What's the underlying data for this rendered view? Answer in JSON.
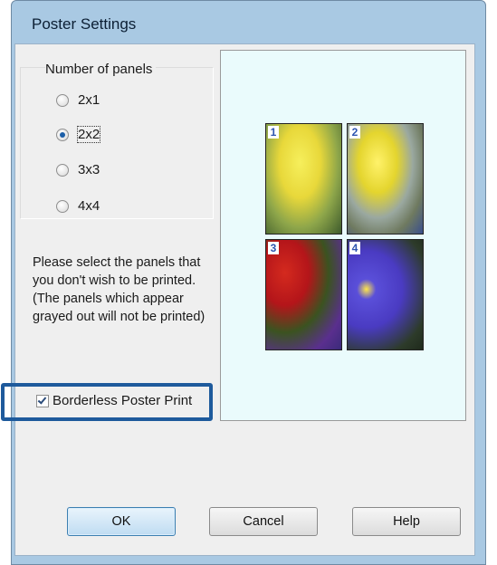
{
  "window": {
    "title": "Poster Settings",
    "colors": {
      "frame": "#a9c9e3",
      "client": "#efefef",
      "preview_bg": "#eafbfc",
      "highlight": "#1e5a9c"
    }
  },
  "panels_group": {
    "legend": "Number of panels",
    "options": [
      {
        "label": "2x1",
        "checked": false
      },
      {
        "label": "2x2",
        "checked": true
      },
      {
        "label": "3x3",
        "checked": false
      },
      {
        "label": "4x4",
        "checked": false
      }
    ]
  },
  "instructions": "Please select the panels that you don't wish to be printed. (The panels which appear grayed out will not be printed)",
  "borderless": {
    "label": "Borderless Poster Print",
    "checked": true
  },
  "preview": {
    "panels": [
      {
        "number": "1"
      },
      {
        "number": "2"
      },
      {
        "number": "3"
      },
      {
        "number": "4"
      }
    ]
  },
  "buttons": {
    "ok": "OK",
    "cancel": "Cancel",
    "help": "Help"
  }
}
